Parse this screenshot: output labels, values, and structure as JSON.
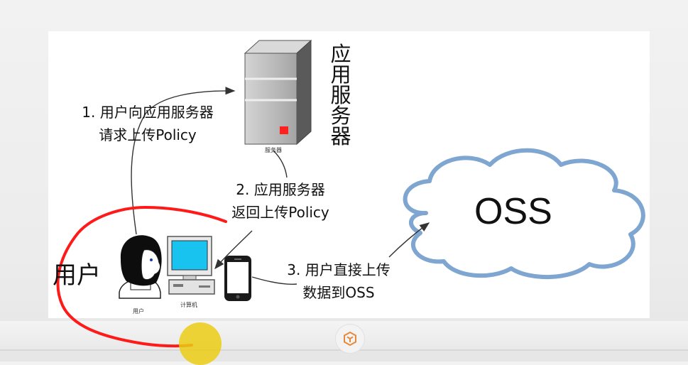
{
  "server": {
    "title_chars": [
      "应",
      "用",
      "服",
      "务",
      "器"
    ],
    "caption": "服务器"
  },
  "steps": {
    "step1_line1": "1. 用户向应用服务器",
    "step1_line2": "请求上传Policy",
    "step2_line1": "2. 应用服务器",
    "step2_line2": "返回上传Policy",
    "step3_line1": "3. 用户直接上传",
    "step3_line2": "数据到OSS"
  },
  "oss": {
    "label": "OSS"
  },
  "user": {
    "label": "用户",
    "caption": "用户"
  },
  "computer": {
    "caption": "计算机"
  },
  "colors": {
    "annotation": "#ff1a1a",
    "cloud_stroke": "#7ea6d0",
    "server_body": "#b9b9b9",
    "server_indicator": "#ff2020",
    "screen": "#18c3f0",
    "cursor": "#ebcd14",
    "logo": "#e8893a"
  },
  "icons": [
    "server-icon",
    "cloud-icon",
    "user-icon",
    "computer-icon",
    "phone-icon",
    "logo-icon"
  ]
}
